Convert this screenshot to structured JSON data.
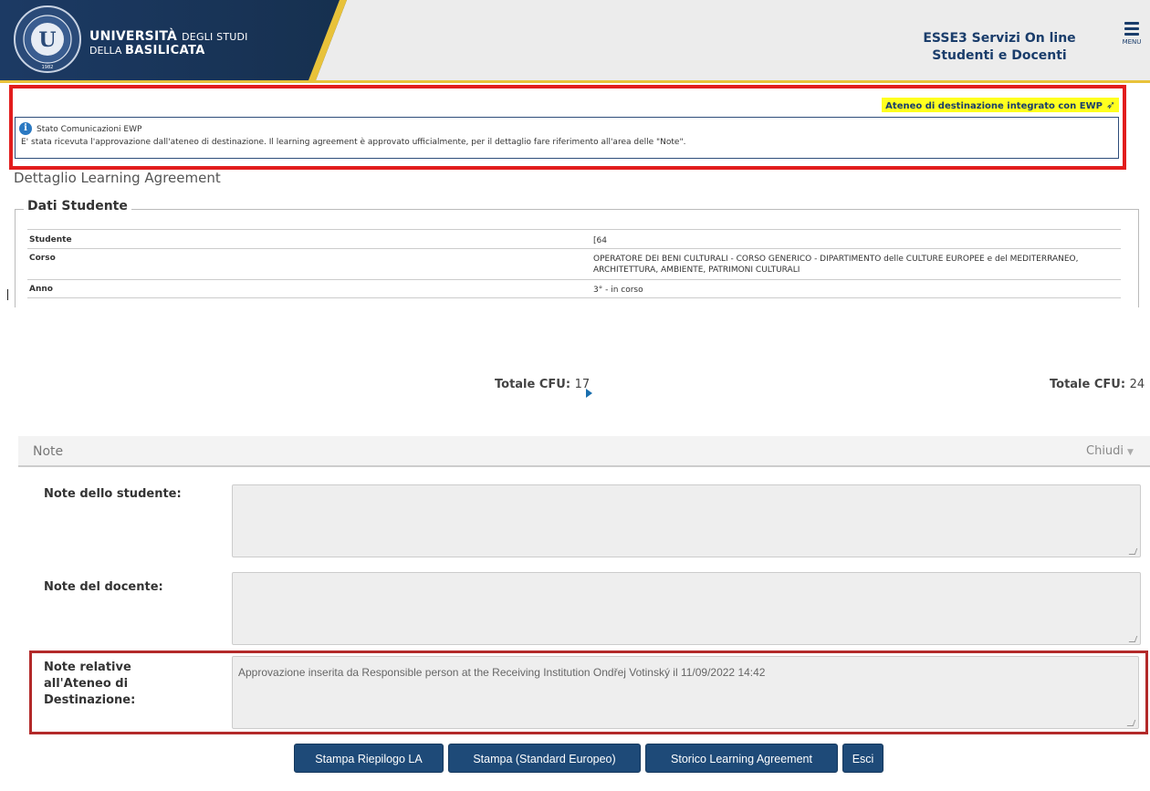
{
  "header": {
    "university_line1_bold": "UNIVERSITÀ",
    "university_line1_light": "DEGLI STUDI",
    "university_line2_light": "DELLA",
    "university_line2_bold": "BASILICATA",
    "service_line1": "ESSE3 Servizi On line",
    "service_line2": "Studenti e Docenti",
    "menu_label": "MENU",
    "brand_color": "#1a3d6b",
    "accent_color": "#e8c23a"
  },
  "ewp": {
    "tag": "Ateneo di destinazione integrato con EWP",
    "tag_icon": "paper-plane-icon",
    "info_title": "Stato Comunicazioni EWP",
    "info_text": "E' stata ricevuta l'approvazione dall'ateneo di destinazione. Il learning agreement è approvato ufficialmente, per il dettaglio fare riferimento all'area delle \"Note\"."
  },
  "page_title": "Dettaglio Learning Agreement",
  "dati_studente": {
    "legend": "Dati Studente",
    "rows": [
      {
        "label": "Studente",
        "value": "[64"
      },
      {
        "label": "Corso",
        "value": "OPERATORE DEI BENI CULTURALI - CORSO GENERICO - DIPARTIMENTO delle CULTURE EUROPEE e del MEDITERRANEO,",
        "value2": "ARCHITETTURA, AMBIENTE, PATRIMONI CULTURALI"
      },
      {
        "label": "Anno",
        "value": "3° - in corso"
      }
    ]
  },
  "totals": {
    "left_label": "Totale CFU:",
    "left_value": "17",
    "right_label": "Totale CFU:",
    "right_value": "24"
  },
  "note_section": {
    "title": "Note",
    "toggle": "Chiudi",
    "student_label": "Note dello studente:",
    "student_value": "",
    "teacher_label": "Note del docente:",
    "teacher_value": "",
    "dest_label_l1": "Note relative",
    "dest_label_l2": "all'Ateneo di",
    "dest_label_l3": "Destinazione:",
    "dest_value": "Approvazione inserita da Responsible person at the Receiving Institution Ondřej Votinský il 11/09/2022 14:42"
  },
  "buttons": {
    "stampa_riepilogo": "Stampa Riepilogo LA",
    "stampa_standard": "Stampa (Standard Europeo)",
    "storico": "Storico Learning Agreement",
    "esci": "Esci"
  }
}
